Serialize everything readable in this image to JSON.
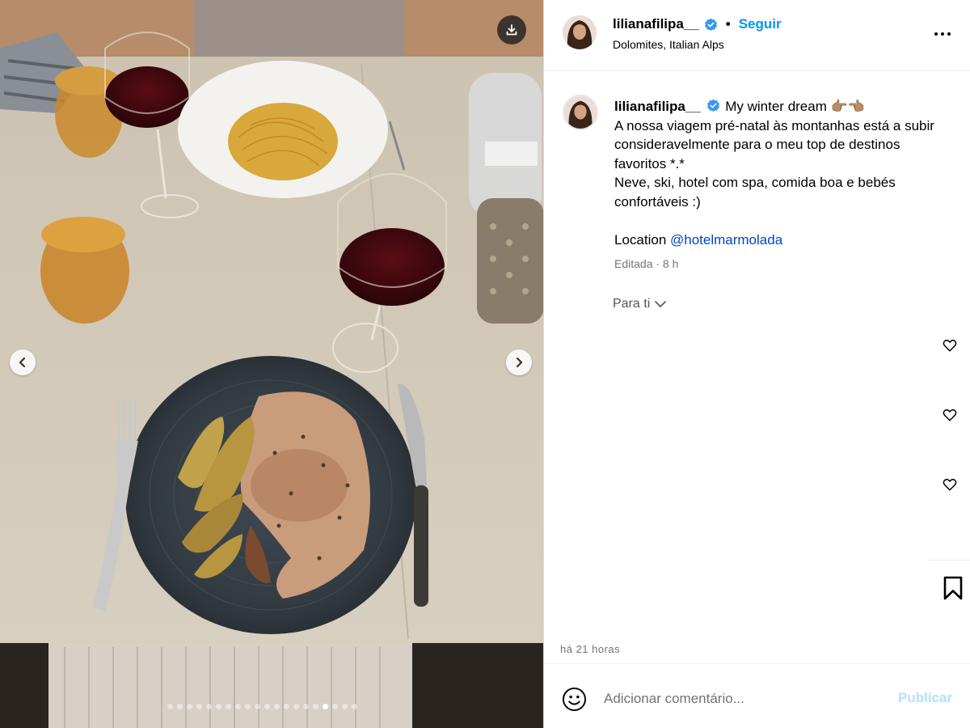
{
  "post": {
    "username": "lilianafilipa__",
    "verified": true,
    "follow_label": "Seguir",
    "separator": "•",
    "location": "Dolomites, Italian Alps"
  },
  "caption": {
    "username": "lilianafilipa__",
    "line1": "My winter dream 👉🏽👈🏽",
    "line2": "A nossa viagem pré-natal às montanhas está a subir consideravelmente para o meu top de destinos favoritos *.*",
    "line3": "Neve, ski, hotel com spa, comida boa e bebés confortáveis :)",
    "location_prefix": "Location ",
    "mention": "@hotelmarmolada",
    "edited": "Editada · 8 h"
  },
  "comments": {
    "sort_label": "Para ti"
  },
  "footer": {
    "time_ago": "há 21 horas",
    "comment_placeholder": "Adicionar comentário...",
    "publish_label": "Publicar"
  },
  "carousel": {
    "total_slides": 20,
    "active_index": 16
  },
  "icons": {
    "download": "download-icon",
    "prev": "chevron-left-icon",
    "next": "chevron-right-icon",
    "more": "more-options-icon",
    "verified": "verified-badge-icon",
    "heart": "heart-icon",
    "bookmark": "bookmark-icon",
    "emoji": "emoji-icon",
    "sort": "chevron-down-icon"
  },
  "colors": {
    "accent": "#0095f6",
    "mention": "#0044c8",
    "publish_disabled": "#b2dffc",
    "muted": "#737373"
  }
}
